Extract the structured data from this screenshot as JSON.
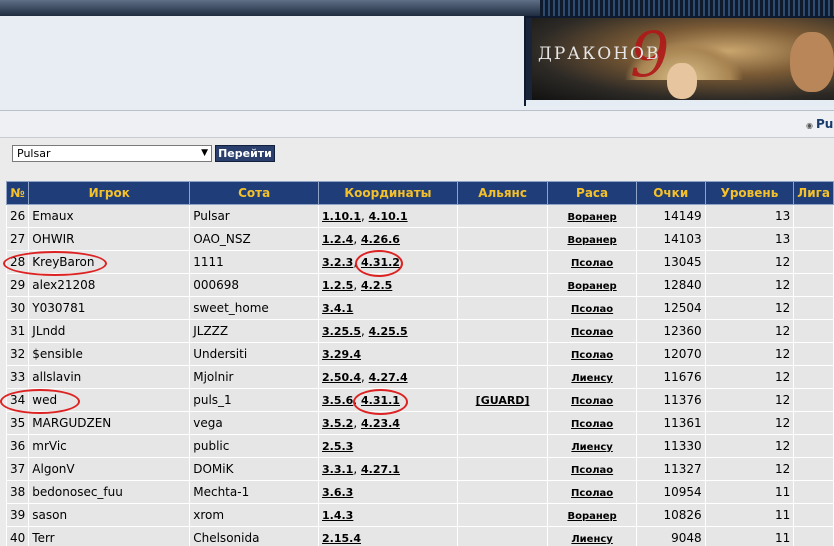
{
  "banner": {
    "title": "ДРАКОНОВ",
    "numeral": "9"
  },
  "breadcrumb": {
    "text": "Pul"
  },
  "selector": {
    "value": "Pulsar",
    "go_label": "Перейти"
  },
  "table": {
    "headers": [
      "№",
      "Игрок",
      "Сота",
      "Координаты",
      "Альянс",
      "Раса",
      "Очки",
      "Уровень",
      "Лига"
    ],
    "rows": [
      {
        "n": "26",
        "player": "Emaux",
        "cell": "Pulsar",
        "c1": "1.10.1",
        "c2": "4.10.1",
        "ally": "",
        "race": "Воранер",
        "score": "14149",
        "level": "13"
      },
      {
        "n": "27",
        "player": "OHWIR",
        "cell": "OAO_NSZ",
        "c1": "1.2.4",
        "c2": "4.26.6",
        "ally": "",
        "race": "Воранер",
        "score": "14103",
        "level": "13"
      },
      {
        "n": "28",
        "player": "KreyBaron",
        "cell": "1111",
        "c1": "3.2.3",
        "c2": "4.31.2",
        "ally": "",
        "race": "Псолао",
        "score": "13045",
        "level": "12"
      },
      {
        "n": "29",
        "player": "alex21208",
        "cell": "000698",
        "c1": "1.2.5",
        "c2": "4.2.5",
        "ally": "",
        "race": "Воранер",
        "score": "12840",
        "level": "12"
      },
      {
        "n": "30",
        "player": "Y030781",
        "cell": "sweet_home",
        "c1": "3.4.1",
        "c2": "",
        "ally": "",
        "race": "Псолао",
        "score": "12504",
        "level": "12"
      },
      {
        "n": "31",
        "player": "JLndd",
        "cell": "JLZZZ",
        "c1": "3.25.5",
        "c2": "4.25.5",
        "ally": "",
        "race": "Псолао",
        "score": "12360",
        "level": "12"
      },
      {
        "n": "32",
        "player": "$ensible",
        "cell": "Undersiti",
        "c1": "3.29.4",
        "c2": "",
        "ally": "",
        "race": "Псолао",
        "score": "12070",
        "level": "12"
      },
      {
        "n": "33",
        "player": "allslavin",
        "cell": "Mjolnir",
        "c1": "2.50.4",
        "c2": "4.27.4",
        "ally": "",
        "race": "Лиенсу",
        "score": "11676",
        "level": "12"
      },
      {
        "n": "34",
        "player": "wed",
        "cell": "puls_1",
        "c1": "3.5.6",
        "c2": "4.31.1",
        "ally": "[GUARD]",
        "race": "Псолао",
        "score": "11376",
        "level": "12"
      },
      {
        "n": "35",
        "player": "MARGUDZEN",
        "cell": "vega",
        "c1": "3.5.2",
        "c2": "4.23.4",
        "ally": "",
        "race": "Псолао",
        "score": "11361",
        "level": "12"
      },
      {
        "n": "36",
        "player": "mrVic",
        "cell": "public",
        "c1": "2.5.3",
        "c2": "",
        "ally": "",
        "race": "Лиенсу",
        "score": "11330",
        "level": "12"
      },
      {
        "n": "37",
        "player": "AlgonV",
        "cell": "DOMiK",
        "c1": "3.3.1",
        "c2": "4.27.1",
        "ally": "",
        "race": "Псолао",
        "score": "11327",
        "level": "12"
      },
      {
        "n": "38",
        "player": "bedonosec_fuu",
        "cell": "Mechta-1",
        "c1": "3.6.3",
        "c2": "",
        "ally": "",
        "race": "Псолао",
        "score": "10954",
        "level": "11"
      },
      {
        "n": "39",
        "player": "sason",
        "cell": "xrom",
        "c1": "1.4.3",
        "c2": "",
        "ally": "",
        "race": "Воранер",
        "score": "10826",
        "level": "11"
      },
      {
        "n": "40",
        "player": "Terr",
        "cell": "Chelsonida",
        "c1": "2.15.4",
        "c2": "",
        "ally": "",
        "race": "Лиенсу",
        "score": "9048",
        "level": "11"
      }
    ]
  },
  "colors": {
    "header_bg": "#1f3e79",
    "header_text": "#f5c12a",
    "row_bg": "#e6e6e6",
    "highlight": "#dd2222"
  }
}
